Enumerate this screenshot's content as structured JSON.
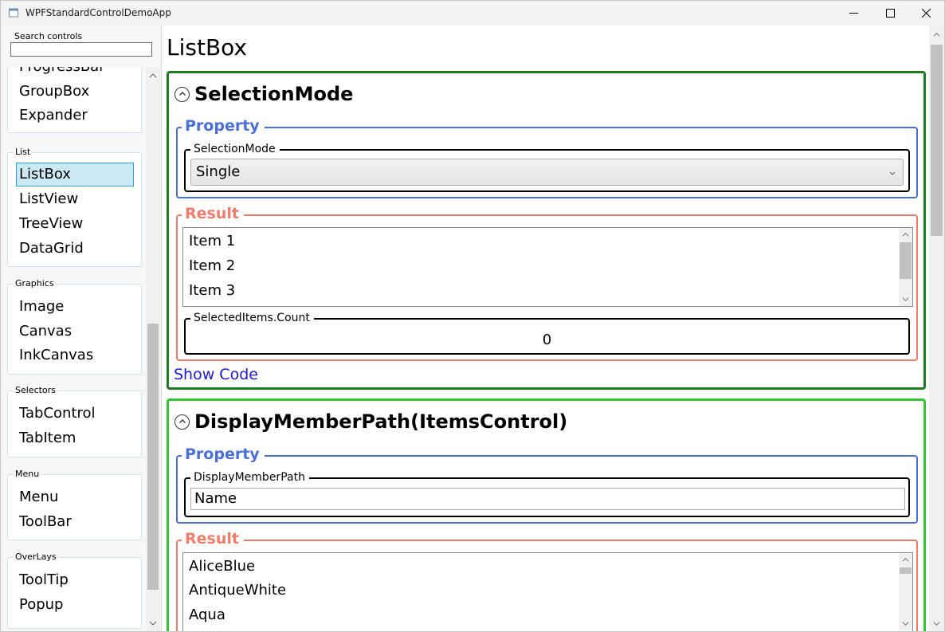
{
  "window": {
    "title": "WPFStandardControlDemoApp"
  },
  "search": {
    "label": "Search controls",
    "value": ""
  },
  "sidebar": {
    "top_items": [
      "ProgressBar",
      "GroupBox",
      "Expander"
    ],
    "groups": [
      {
        "header": "List",
        "items": [
          "ListBox",
          "ListView",
          "TreeView",
          "DataGrid"
        ]
      },
      {
        "header": "Graphics",
        "items": [
          "Image",
          "Canvas",
          "InkCanvas"
        ]
      },
      {
        "header": "Selectors",
        "items": [
          "TabControl",
          "TabItem"
        ]
      },
      {
        "header": "Menu",
        "items": [
          "Menu",
          "ToolBar"
        ]
      },
      {
        "header": "OverLays",
        "items": [
          "ToolTip",
          "Popup"
        ]
      }
    ],
    "selected": "ListBox"
  },
  "main": {
    "page_title": "ListBox",
    "sections": [
      {
        "title": "SelectionMode",
        "property_legend": "Property",
        "property_label": "SelectionMode",
        "property_value": "Single",
        "result_legend": "Result",
        "list_items": [
          "Item 1",
          "Item 2",
          "Item 3"
        ],
        "count_label": "SelectedItems.Count",
        "count_value": "0",
        "show_code": "Show Code"
      },
      {
        "title": "DisplayMemberPath(ItemsControl)",
        "property_legend": "Property",
        "property_label": "DisplayMemberPath",
        "property_value": "Name",
        "result_legend": "Result",
        "list_items": [
          "AliceBlue",
          "AntiqueWhite",
          "Aqua"
        ]
      }
    ]
  },
  "colors": {
    "section1_border": "#1f7b1f",
    "section2_border": "#32c832",
    "property_border": "#4a6fd6",
    "result_border": "#f07b6b",
    "link": "#1a1ad6",
    "selected_bg": "#cce8f4"
  },
  "icons": {
    "app": "window-icon",
    "minimize": "minimize-icon",
    "maximize": "maximize-icon",
    "close": "close-icon",
    "expander": "chevron-up-circle-icon",
    "combo": "chevron-down-icon"
  }
}
